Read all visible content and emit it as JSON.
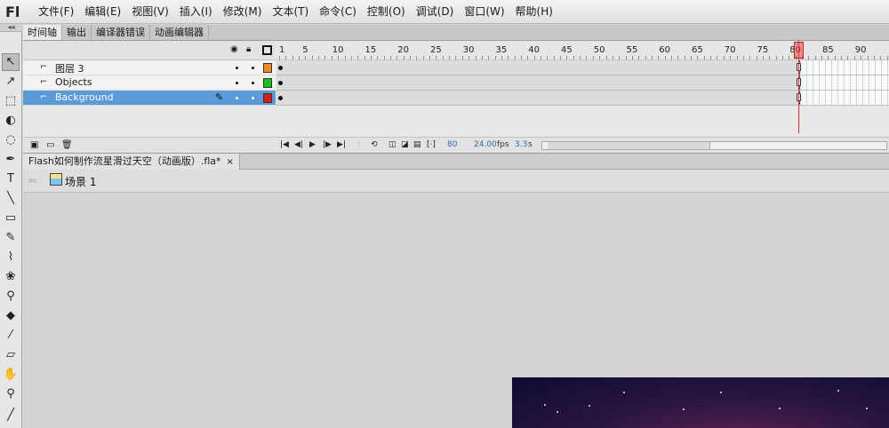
{
  "app": {
    "logo": "Fl"
  },
  "menu": [
    "文件(F)",
    "编辑(E)",
    "视图(V)",
    "插入(I)",
    "修改(M)",
    "文本(T)",
    "命令(C)",
    "控制(O)",
    "调试(D)",
    "窗口(W)",
    "帮助(H)"
  ],
  "panel_tabs": [
    "时间轴",
    "输出",
    "编译器错误",
    "动画编辑器"
  ],
  "timeline": {
    "ruler_numbers": [
      "1",
      "5",
      "10",
      "15",
      "20",
      "25",
      "30",
      "35",
      "40",
      "45",
      "50",
      "55",
      "60",
      "65",
      "70",
      "75",
      "80",
      "85",
      "90"
    ],
    "layers": [
      {
        "name": "图层 3",
        "color": "#f08a1e",
        "selected": false
      },
      {
        "name": "Objects",
        "color": "#19c419",
        "selected": false
      },
      {
        "name": "Background",
        "color": "#e01818",
        "selected": true
      }
    ],
    "current_frame": "80",
    "frame_rate": "24.00",
    "frame_rate_unit": "fps",
    "elapsed": "3.3",
    "elapsed_unit": "s"
  },
  "document": {
    "tab_title": "Flash如何制作流星滑过天空（动画版）.fla*",
    "close_glyph": "×"
  },
  "edit_bar": {
    "scene_name": "场景 1"
  },
  "icons": {
    "eye": "eye-icon",
    "lock": "lock-icon",
    "outline": "outline-icon",
    "layer": "layer-icon",
    "pencil": "pencil-icon"
  }
}
